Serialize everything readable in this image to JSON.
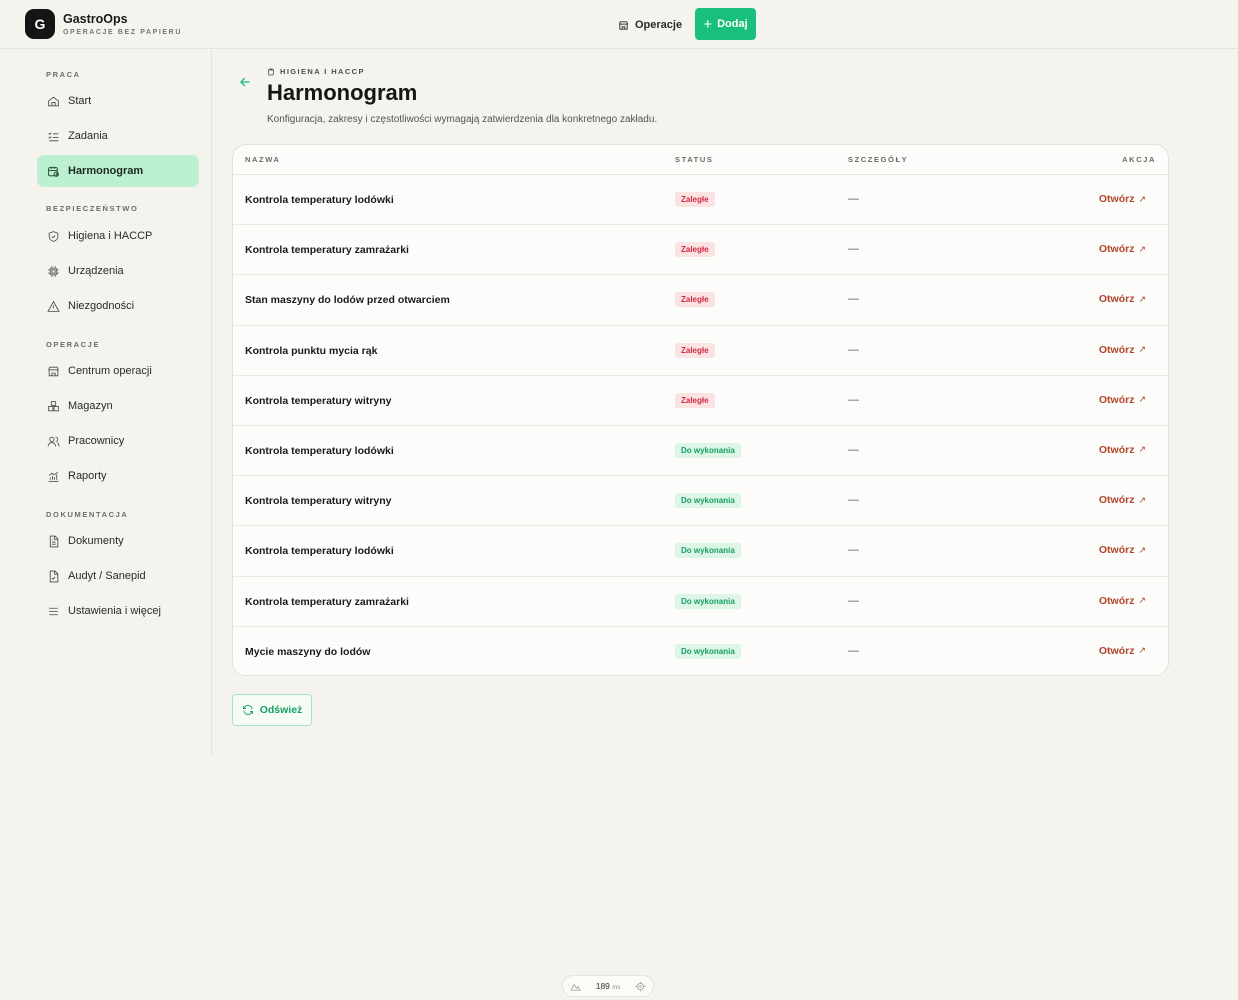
{
  "app": {
    "logo_letter": "G",
    "name": "GastroOps",
    "tagline": "OPERACJE BEZ PAPIERU"
  },
  "header": {
    "ops_label": "Operacje",
    "add_label": "Dodaj",
    "accent_color": "#19bf7c"
  },
  "sidebar": {
    "sections": [
      {
        "title": "PRACA"
      },
      {
        "title": "BEZPIECZEŃSTWO"
      },
      {
        "title": "OPERACJE"
      },
      {
        "title": "DOKUMENTACJA"
      }
    ],
    "items": [
      {
        "label": "Start",
        "icon": "home-icon"
      },
      {
        "label": "Zadania",
        "icon": "checklist-icon"
      },
      {
        "label": "Harmonogram",
        "icon": "calendar-clock-icon",
        "active": true
      },
      {
        "label": "Higiena i HACCP",
        "icon": "shield-icon"
      },
      {
        "label": "Urządzenia",
        "icon": "chip-icon"
      },
      {
        "label": "Niezgodności",
        "icon": "warning-icon"
      },
      {
        "label": "Centrum operacji",
        "icon": "store-icon"
      },
      {
        "label": "Magazyn",
        "icon": "boxes-icon"
      },
      {
        "label": "Pracownicy",
        "icon": "users-icon"
      },
      {
        "label": "Raporty",
        "icon": "chart-icon"
      },
      {
        "label": "Dokumenty",
        "icon": "document-icon"
      },
      {
        "label": "Audyt / Sanepid",
        "icon": "file-check-icon"
      },
      {
        "label": "Ustawienia i więcej",
        "icon": "menu-icon"
      }
    ]
  },
  "page": {
    "breadcrumb": "HIGIENA I HACCP",
    "title": "Harmonogram",
    "description": "Konfiguracja, zakresy i częstotliwości wymagają zatwierdzenia dla konkretnego zakładu."
  },
  "table": {
    "columns": {
      "name": "NAZWA",
      "status": "STATUS",
      "details": "SZCZEGÓŁY",
      "action": "AKCJA"
    },
    "rows": [
      {
        "name": "Kontrola temperatury lodówki",
        "status": "Zaległe",
        "status_type": "overdue",
        "details": "—",
        "action": "Otwórz"
      },
      {
        "name": "Kontrola temperatury zamrażarki",
        "status": "Zaległe",
        "status_type": "overdue",
        "details": "—",
        "action": "Otwórz"
      },
      {
        "name": "Stan maszyny do lodów przed otwarciem",
        "status": "Zaległe",
        "status_type": "overdue",
        "details": "—",
        "action": "Otwórz"
      },
      {
        "name": "Kontrola punktu mycia rąk",
        "status": "Zaległe",
        "status_type": "overdue",
        "details": "—",
        "action": "Otwórz"
      },
      {
        "name": "Kontrola temperatury witryny",
        "status": "Zaległe",
        "status_type": "overdue",
        "details": "—",
        "action": "Otwórz"
      },
      {
        "name": "Kontrola temperatury lodówki",
        "status": "Do wykonania",
        "status_type": "todo",
        "details": "—",
        "action": "Otwórz"
      },
      {
        "name": "Kontrola temperatury witryny",
        "status": "Do wykonania",
        "status_type": "todo",
        "details": "—",
        "action": "Otwórz"
      },
      {
        "name": "Kontrola temperatury lodówki",
        "status": "Do wykonania",
        "status_type": "todo",
        "details": "—",
        "action": "Otwórz"
      },
      {
        "name": "Kontrola temperatury zamrażarki",
        "status": "Do wykonania",
        "status_type": "todo",
        "details": "—",
        "action": "Otwórz"
      },
      {
        "name": "Mycie maszyny do lodów",
        "status": "Do wykonania",
        "status_type": "todo",
        "details": "—",
        "action": "Otwórz"
      }
    ]
  },
  "refresh_label": "Odśwież",
  "perf": {
    "value": "189",
    "unit": "ms"
  }
}
